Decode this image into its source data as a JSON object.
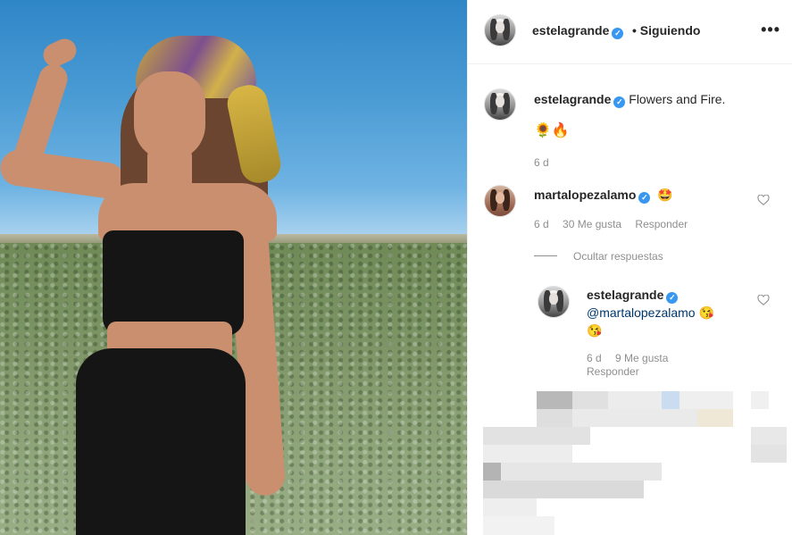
{
  "header": {
    "username": "estelagrande",
    "verified_badge": "✓",
    "follow_status": "• Siguiendo",
    "more_icon": "•••"
  },
  "caption": {
    "username": "estelagrande",
    "text": "Flowers and Fire.",
    "emojis": "🌻🔥",
    "time": "6 d"
  },
  "comments": [
    {
      "username": "martalopezalamo",
      "text": "🤩",
      "time": "6 d",
      "likes": "30 Me gusta",
      "reply": "Responder"
    }
  ],
  "replies_toggle": "Ocultar respuestas",
  "replies": [
    {
      "username": "estelagrande",
      "mention": "@martalopezalamo",
      "emoji1": "😘",
      "emoji2": "😘",
      "time": "6 d",
      "likes": "9 Me gusta",
      "reply": "Responder"
    }
  ],
  "colors": {
    "verified": "#3897f0",
    "mention": "#00376b",
    "meta": "#8e8e8e"
  }
}
